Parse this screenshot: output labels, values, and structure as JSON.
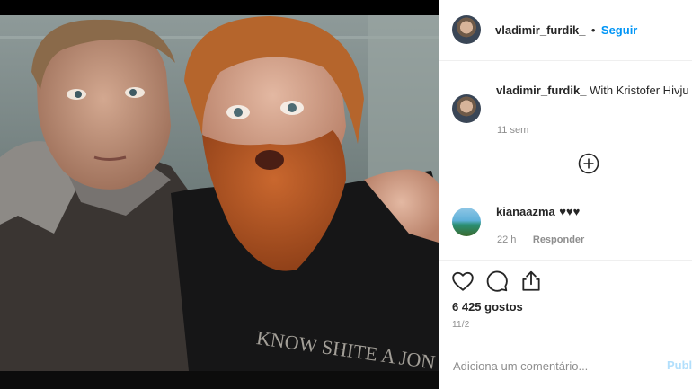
{
  "post": {
    "author": "vladimir_furdik_",
    "follow_separator": "•",
    "follow_label": "Seguir",
    "caption_user": "vladimir_furdik_",
    "caption_text": "With Kristofer Hivju a man with a big heart",
    "caption_time": "11 sem",
    "likes": "6 425 gostos",
    "date": "11/2"
  },
  "photo": {
    "shirt_text": "KNOW SHITE A JON SN"
  },
  "comments": [
    {
      "user": "kianaazma",
      "text": "♥♥♥",
      "time": "22 h",
      "reply_label": "Responder"
    }
  ],
  "load_more_icon": "plus-circle-icon",
  "add_comment": {
    "placeholder": "Adiciona um comentário...",
    "publish_label": "Publicar"
  },
  "colors": {
    "link_blue": "#0095f6",
    "publish_disabled": "#b2dffc",
    "border": "#efefef",
    "muted": "#8e8e8e"
  }
}
